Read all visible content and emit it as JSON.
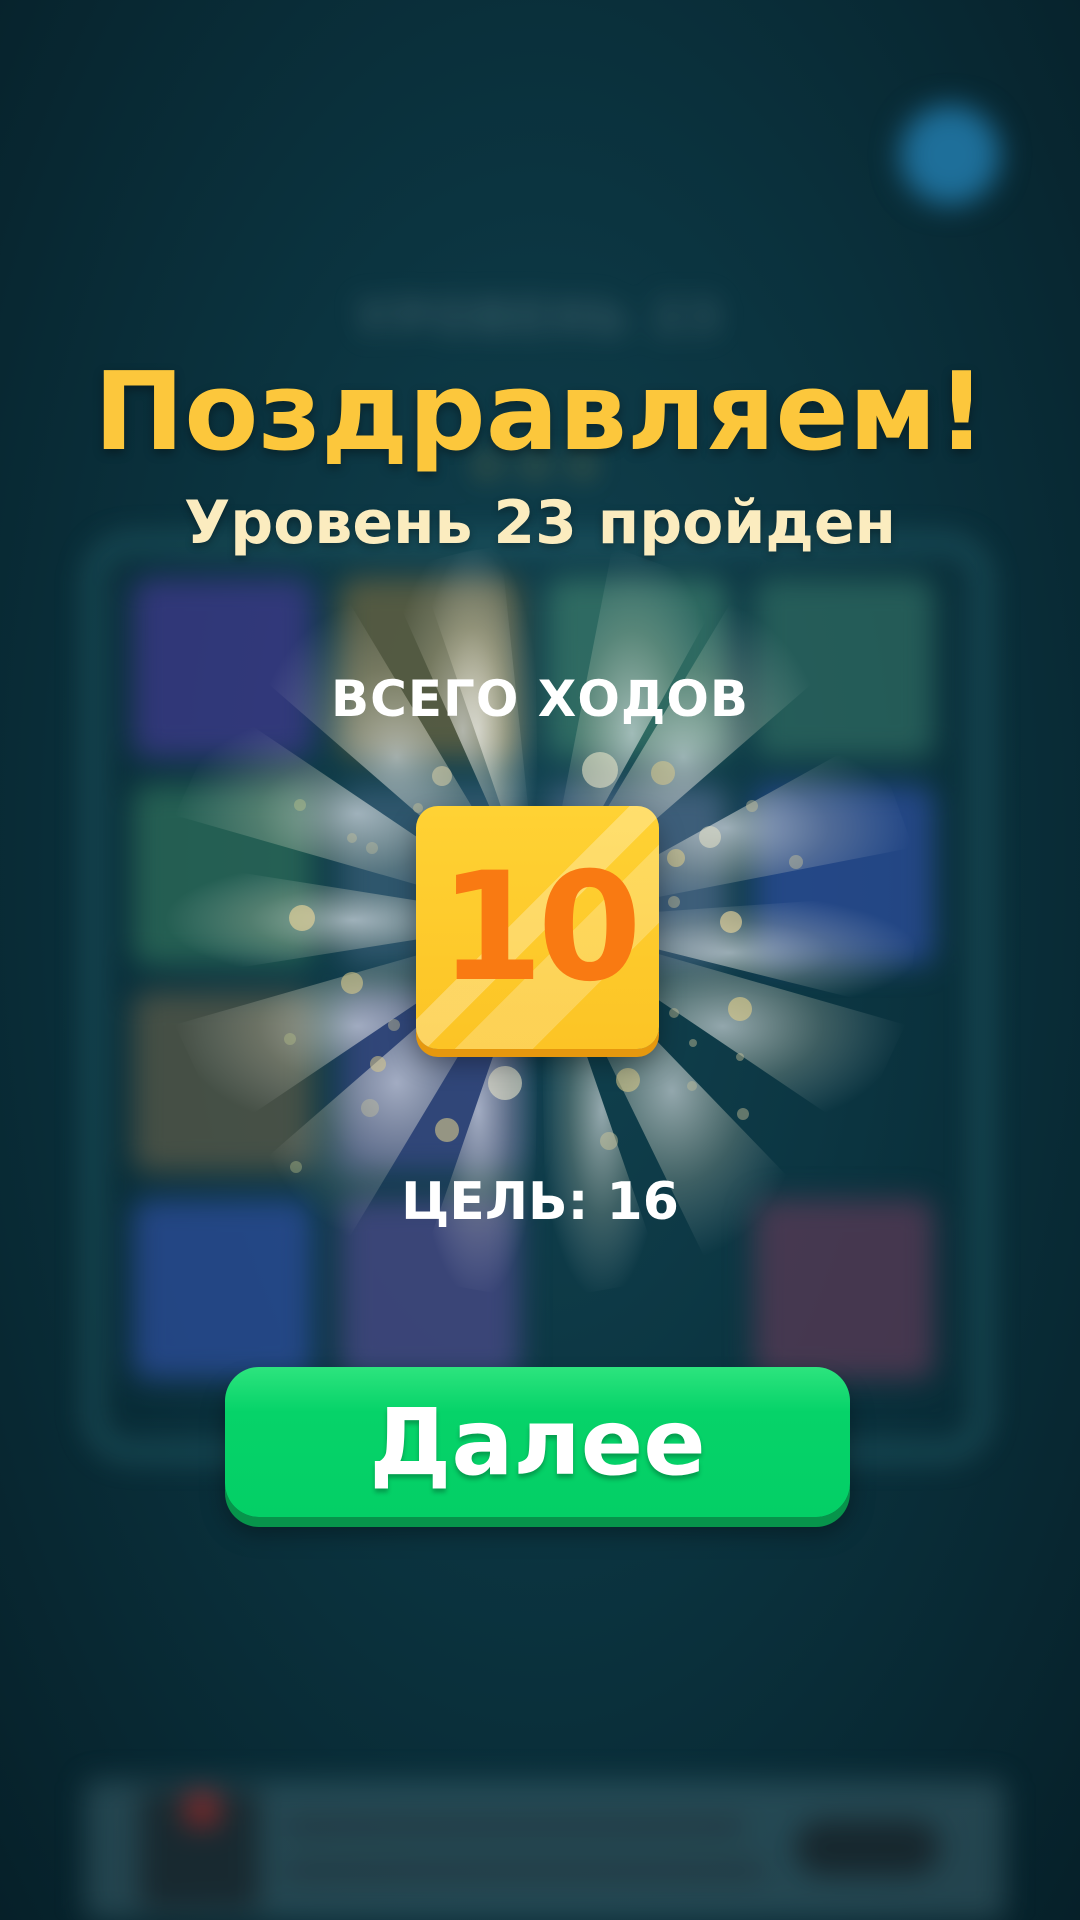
{
  "dialog": {
    "title": "Поздравляем!",
    "subtitle": "Уровень 23 пройден",
    "moves_label": "ВСЕГО ХОДОВ",
    "moves_value": "10",
    "goal_label": "ЦЕЛЬ: 16",
    "next_button": "Далее"
  },
  "background": {
    "level_title": "УРОВЕНЬ 23",
    "stars": "★★★",
    "board_tile_colors": [
      "#3d3a8c",
      "#6b6440",
      "#3a7a6a",
      "#2d6a60",
      "#2e6e5a",
      "#3a5f78",
      "#4e6a8a",
      "#2c4e9c",
      "#5a5a48",
      "#3c4a88",
      "",
      "",
      "#2c4e9c",
      "#4a4a88",
      "",
      "#5a3a55"
    ]
  },
  "colors": {
    "title": "#fcc73c",
    "subtitle": "#fbecbf",
    "tile": "#fcc425",
    "tile_number": "#f97a12",
    "button": "#04cf66"
  }
}
